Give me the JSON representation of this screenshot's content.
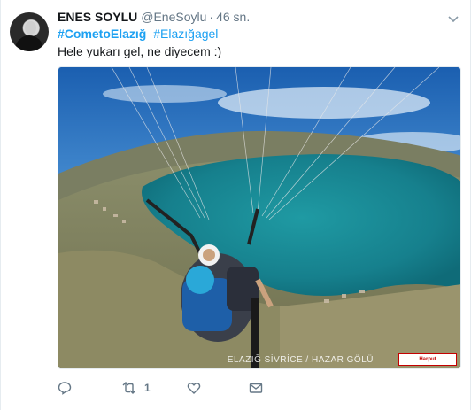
{
  "tweet": {
    "author_name": "ENES SOYLU",
    "author_handle": "@EneSoylu",
    "separator": "·",
    "time": "46 sn.",
    "hashtags": [
      "#CometoElazığ",
      "#Elazığagel"
    ],
    "text": "Hele yukarı gel, ne diyecem :)",
    "media": {
      "watermark": "ELAZIĞ SİVRİCE / HAZAR GÖLÜ",
      "logo_text": "Harput"
    },
    "actions": {
      "reply_icon": "reply-icon",
      "retweet_icon": "retweet-icon",
      "retweet_count": "1",
      "like_icon": "heart-icon",
      "message_icon": "envelope-icon"
    }
  },
  "colors": {
    "link": "#1da1f2",
    "secondary_text": "#657786",
    "primary_text": "#14171a",
    "border": "#e6ecf0"
  }
}
